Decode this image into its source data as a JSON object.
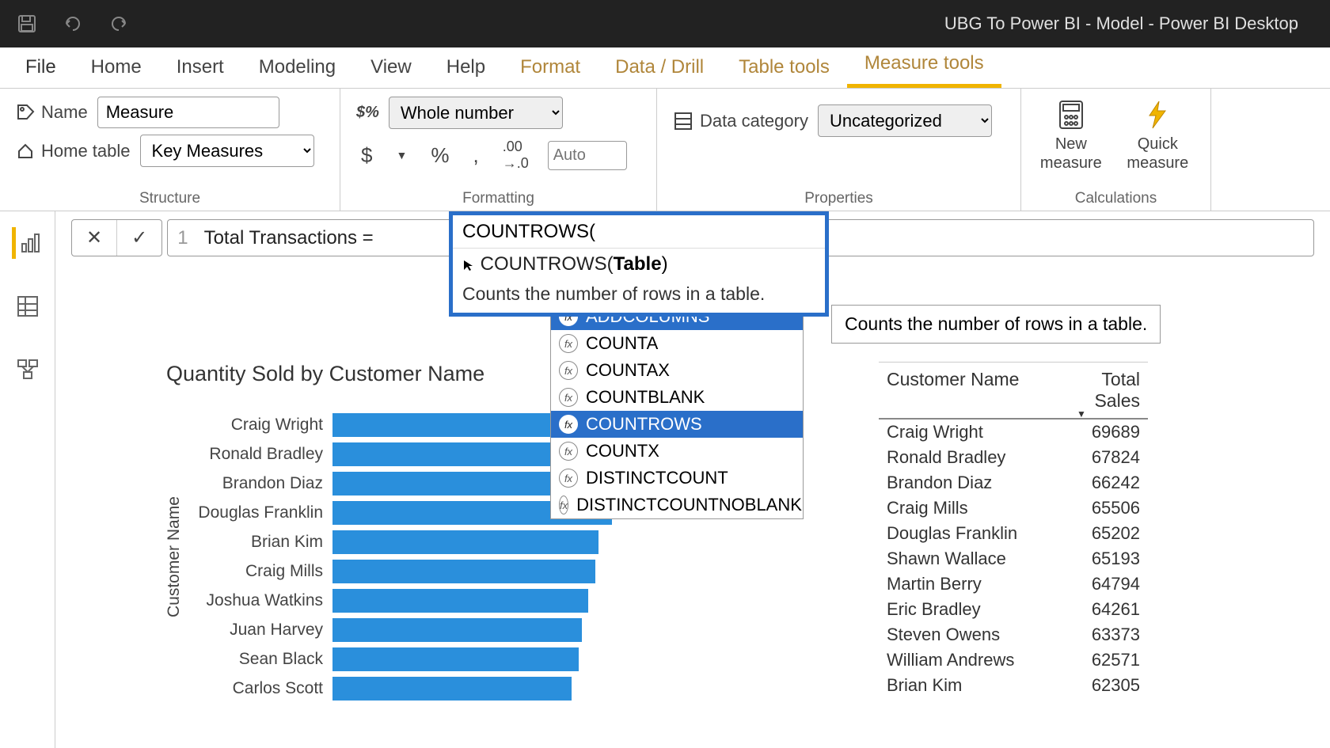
{
  "window": {
    "title": "UBG To Power BI - Model - Power BI Desktop"
  },
  "tabs": {
    "file": "File",
    "home": "Home",
    "insert": "Insert",
    "modeling": "Modeling",
    "view": "View",
    "help": "Help",
    "format": "Format",
    "data_drill": "Data / Drill",
    "table_tools": "Table tools",
    "measure_tools": "Measure tools"
  },
  "ribbon": {
    "structure": {
      "name_label": "Name",
      "name_value": "Measure",
      "home_table_label": "Home table",
      "home_table_value": "Key Measures",
      "group": "Structure"
    },
    "formatting": {
      "type": "Whole number",
      "decimals": "Auto",
      "group": "Formatting",
      "dollar": "$",
      "percent": "%",
      "comma": ","
    },
    "properties": {
      "label": "Data category",
      "value": "Uncategorized",
      "group": "Properties"
    },
    "calculations": {
      "new_measure": "New measure",
      "quick_measure": "Quick measure",
      "group": "Calculations"
    }
  },
  "formula": {
    "line": "1",
    "prefix": "Total Transactions = ",
    "function": "COUNTROWS(",
    "signature_func": "COUNTROWS(",
    "signature_param": "Table",
    "signature_close": ")",
    "description": "Counts the number of rows in a table."
  },
  "autocomplete": {
    "items": [
      "ADDCOLUMNS",
      "COUNTA",
      "COUNTAX",
      "COUNTBLANK",
      "COUNTROWS",
      "COUNTX",
      "DISTINCTCOUNT",
      "DISTINCTCOUNTNOBLANK"
    ],
    "highlighted": 0,
    "selected": 4,
    "side_help": "Counts the number of rows in a table."
  },
  "chart_data": {
    "type": "bar",
    "title": "Quantity Sold by Customer Name",
    "ylabel": "Customer Name",
    "categories": [
      "Craig Wright",
      "Ronald Bradley",
      "Brandon Diaz",
      "Douglas Franklin",
      "Brian Kim",
      "Craig Mills",
      "Joshua Watkins",
      "Juan Harvey",
      "Sean Black",
      "Carlos Scott"
    ],
    "values": [
      480,
      455,
      445,
      420,
      400,
      395,
      385,
      375,
      370,
      360
    ],
    "xlim": [
      0,
      500
    ]
  },
  "table": {
    "headers": {
      "name": "Customer Name",
      "sales": "Total Sales"
    },
    "rows": [
      {
        "name": "Craig Wright",
        "sales": 69689
      },
      {
        "name": "Ronald Bradley",
        "sales": 67824
      },
      {
        "name": "Brandon Diaz",
        "sales": 66242
      },
      {
        "name": "Craig Mills",
        "sales": 65506
      },
      {
        "name": "Douglas Franklin",
        "sales": 65202
      },
      {
        "name": "Shawn Wallace",
        "sales": 65193
      },
      {
        "name": "Martin Berry",
        "sales": 64794
      },
      {
        "name": "Eric Bradley",
        "sales": 64261
      },
      {
        "name": "Steven Owens",
        "sales": 63373
      },
      {
        "name": "William Andrews",
        "sales": 62571
      },
      {
        "name": "Brian Kim",
        "sales": 62305
      }
    ]
  }
}
